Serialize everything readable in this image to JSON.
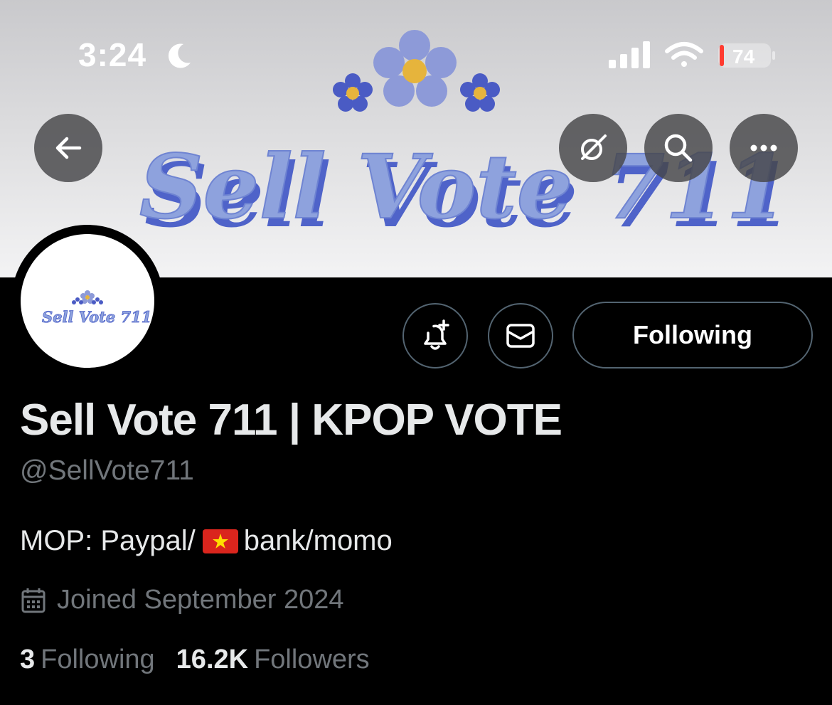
{
  "status_bar": {
    "time": "3:24",
    "battery": "74"
  },
  "banner": {
    "text": "Sell Vote 711"
  },
  "avatar": {
    "text": "Sell Vote 711"
  },
  "actions": {
    "following_label": "Following"
  },
  "profile": {
    "name": "Sell Vote 711 | KPOP VOTE",
    "handle": "@SellVote711",
    "bio_prefix": "MOP: Paypal/",
    "bio_suffix": "bank/momo",
    "joined": "Joined September 2024",
    "following_count": "3",
    "following_label": "Following",
    "followers_count": "16.2K",
    "followers_label": "Followers"
  },
  "colors": {
    "banner_text": "#8ea2dd",
    "banner_shadow": "#4f63c9",
    "flower_petal": "#8d9ad8",
    "flower_center": "#e6b43c",
    "muted_text": "#71767b",
    "battery_low": "#ff3b30"
  },
  "icons": [
    "back-arrow-icon",
    "grok-icon",
    "search-icon",
    "more-icon",
    "notification-bell-icon",
    "mail-icon",
    "calendar-icon",
    "moon-icon",
    "signal-icon",
    "wifi-icon",
    "battery-icon"
  ]
}
